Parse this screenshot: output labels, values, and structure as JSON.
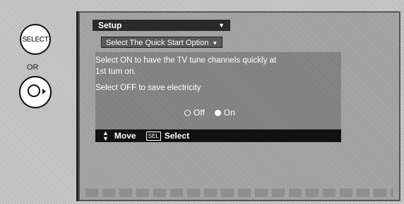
{
  "remote": {
    "select_button_label": "SELECT",
    "or_label": "OR"
  },
  "screen": {
    "menu_tab": "Setup",
    "menu_tab_arrow": "▼",
    "sub_option": "Select The Quick Start Option",
    "sub_option_arrow": "▼",
    "message_line1": "Select ON to have the TV tune channels quickly at",
    "message_line2": "1st turn on.",
    "message_line3": "Select OFF to save electricity",
    "options": [
      {
        "label": "Off",
        "selected": false
      },
      {
        "label": "On",
        "selected": true
      }
    ],
    "help_bar": {
      "move_label": "Move",
      "sel_key": "SEL",
      "select_label": "Select"
    }
  }
}
